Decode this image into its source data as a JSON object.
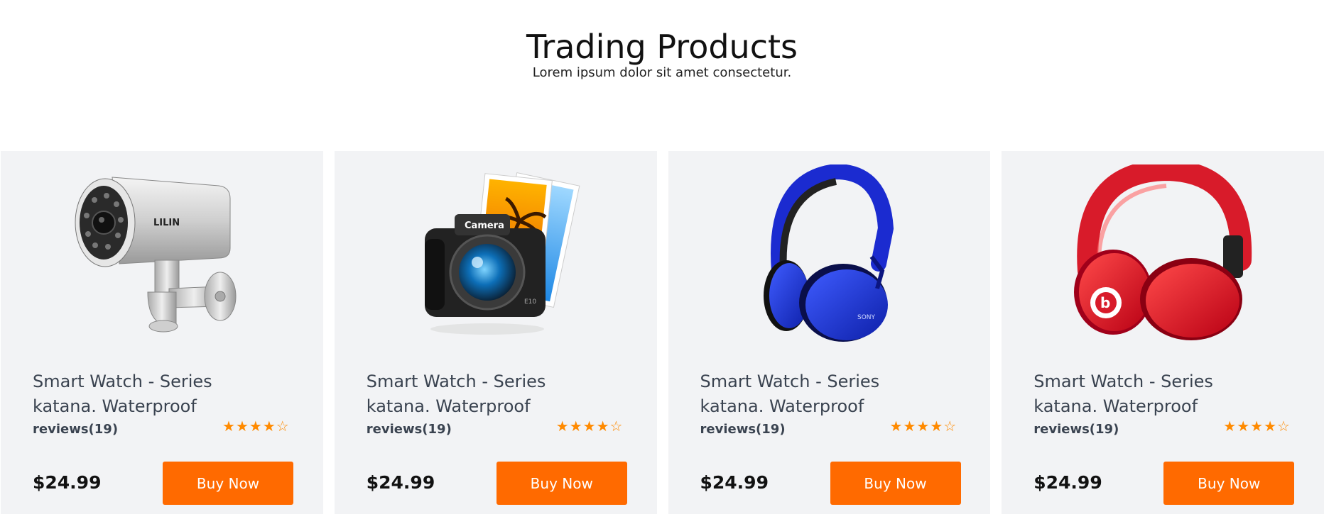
{
  "section": {
    "title": "Trading Products",
    "subtitle": "Lorem ipsum dolor sit amet consectetur."
  },
  "products": [
    {
      "image_icon": "security-camera-icon",
      "name": "Smart Watch - Series katana. Waterproof",
      "reviews": "reviews(19)",
      "rating": 4,
      "rating_max": 5,
      "price": "$24.99",
      "button_label": "Buy Now"
    },
    {
      "image_icon": "camera-icon",
      "name": "Smart Watch - Series katana. Waterproof",
      "reviews": "reviews(19)",
      "rating": 4,
      "rating_max": 5,
      "price": "$24.99",
      "button_label": "Buy Now"
    },
    {
      "image_icon": "blue-headphones-icon",
      "name": "Smart Watch - Series katana. Waterproof",
      "reviews": "reviews(19)",
      "rating": 4,
      "rating_max": 5,
      "price": "$24.99",
      "button_label": "Buy Now"
    },
    {
      "image_icon": "red-headphones-icon",
      "name": "Smart Watch - Series katana. Waterproof",
      "reviews": "reviews(19)",
      "rating": 4,
      "rating_max": 5,
      "price": "$24.99",
      "button_label": "Buy Now"
    }
  ],
  "colors": {
    "accent": "#ff6a00",
    "star": "#ff8a00",
    "card_bg": "#f2f3f5",
    "text": "#3a4350"
  }
}
